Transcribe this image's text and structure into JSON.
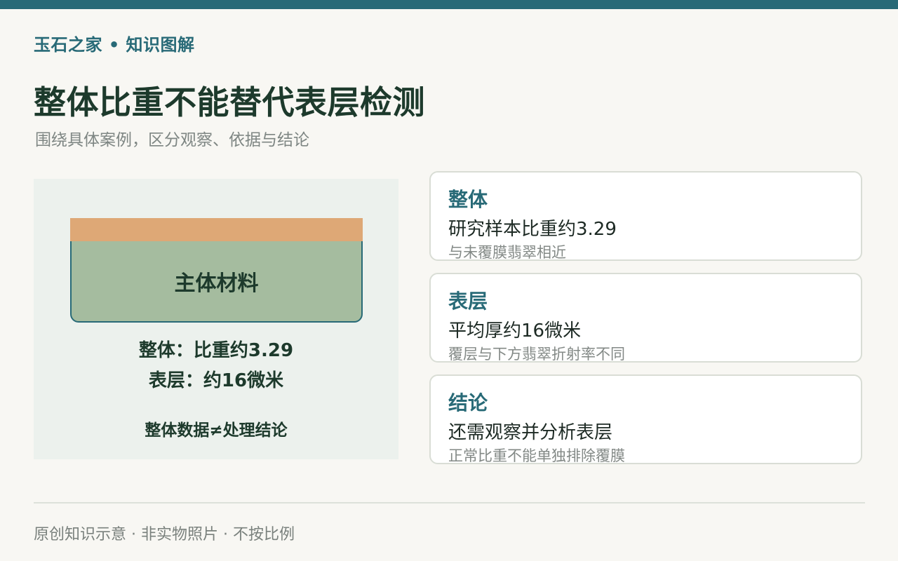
{
  "header": {
    "brand": "玉石之家 • 知识图解",
    "title": "整体比重不能替代表层检测",
    "subtitle": "围绕具体案例，区分观察、依据与结论"
  },
  "diagram": {
    "body_label": "主体材料",
    "line1": "整体：比重约3.29",
    "line2": "表层：约16微米",
    "line3": "整体数据≠处理结论",
    "colors": {
      "coating": "#dea876",
      "body": "#a5bc9f",
      "outline": "#286a77",
      "panel": "#ecf1ed"
    }
  },
  "cards": [
    {
      "title": "整体",
      "main": "研究样本比重约3.29",
      "note": "与未覆膜翡翠相近"
    },
    {
      "title": "表层",
      "main": "平均厚约16微米",
      "note": "覆层与下方翡翠折射率不同"
    },
    {
      "title": "结论",
      "main": "还需观察并分析表层",
      "note": "正常比重不能单独排除覆膜"
    }
  ],
  "footer": {
    "text": "原创知识示意 · 非实物照片 · 不按比例"
  },
  "theme": {
    "accent": "#286a77",
    "heading": "#1d3a2c",
    "background": "#f8f7f3"
  }
}
